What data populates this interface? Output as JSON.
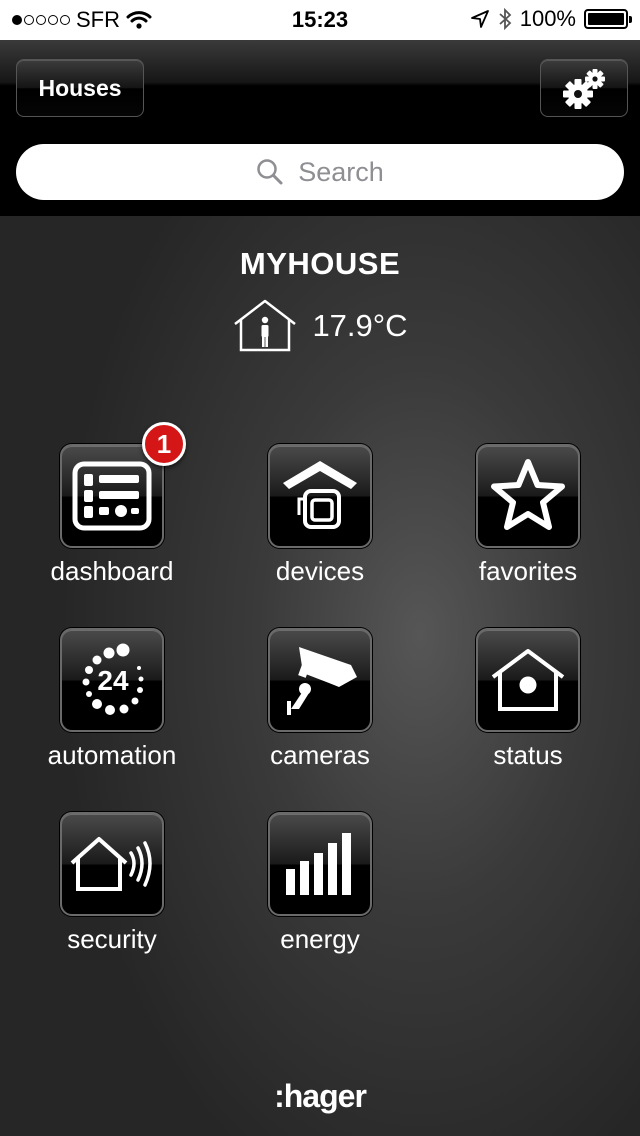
{
  "status_bar": {
    "carrier": "SFR",
    "signal_bars_filled": 1,
    "signal_bars_total": 5,
    "time": "15:23",
    "battery": "100%",
    "battery_level": 1.0
  },
  "nav": {
    "houses_label": "Houses",
    "settings_icon": "gears-icon"
  },
  "search": {
    "placeholder": "Search",
    "icon": "search-icon"
  },
  "house": {
    "name": "MYHOUSE",
    "temperature": "17.9°C",
    "icon": "house-person-icon"
  },
  "tiles": [
    {
      "label": "dashboard",
      "icon": "dashboard-icon",
      "badge": "1"
    },
    {
      "label": "devices",
      "icon": "devices-icon"
    },
    {
      "label": "favorites",
      "icon": "star-icon"
    },
    {
      "label": "automation",
      "icon": "automation-24-icon",
      "icon_text": "24"
    },
    {
      "label": "cameras",
      "icon": "camera-icon"
    },
    {
      "label": "status",
      "icon": "house-status-icon"
    },
    {
      "label": "security",
      "icon": "security-icon"
    },
    {
      "label": "energy",
      "icon": "energy-bars-icon"
    }
  ],
  "footer": {
    "logo": ":hager"
  },
  "colors": {
    "badge": "#d51616",
    "background": "#2b2b2b"
  }
}
